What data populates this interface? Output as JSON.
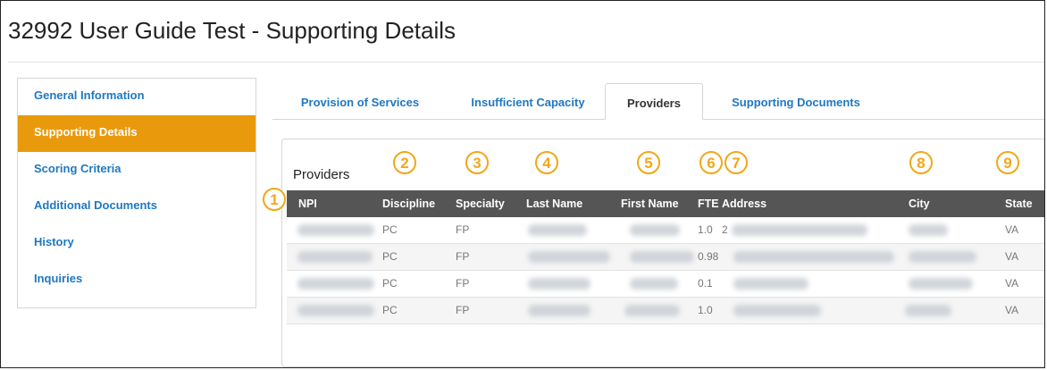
{
  "page": {
    "title": "32992 User Guide Test - Supporting Details"
  },
  "sidebar": {
    "items": [
      {
        "label": "General Information"
      },
      {
        "label": "Supporting Details"
      },
      {
        "label": "Scoring Criteria"
      },
      {
        "label": "Additional Documents"
      },
      {
        "label": "History"
      },
      {
        "label": "Inquiries"
      }
    ],
    "active_item": "Supporting Details",
    "active_color": "#e99a0c"
  },
  "tabs": {
    "items": [
      {
        "label": "Provision of Services"
      },
      {
        "label": "Insufficient Capacity"
      },
      {
        "label": "Providers"
      },
      {
        "label": "Supporting Documents"
      }
    ],
    "active_tab": "Providers"
  },
  "providers": {
    "heading": "Providers",
    "columns": [
      "NPI",
      "Discipline",
      "Specialty",
      "Last Name",
      "First Name",
      "FTE",
      "Address",
      "City",
      "State"
    ],
    "rows": [
      {
        "discipline": "PC",
        "specialty": "FP",
        "fte": "1.0",
        "address_prefix": "2",
        "state": "VA"
      },
      {
        "discipline": "PC",
        "specialty": "FP",
        "fte": "0.98",
        "address_prefix": "",
        "state": "VA"
      },
      {
        "discipline": "PC",
        "specialty": "FP",
        "fte": "0.1",
        "address_prefix": "",
        "state": "VA"
      },
      {
        "discipline": "PC",
        "specialty": "FP",
        "fte": "1.0",
        "address_prefix": "",
        "state": "VA"
      }
    ],
    "redacted_fields": [
      "NPI",
      "Last Name",
      "First Name",
      "Address",
      "City"
    ]
  },
  "callouts": [
    "1",
    "2",
    "3",
    "4",
    "5",
    "6",
    "7",
    "8",
    "9"
  ],
  "colors": {
    "link": "#1f78c1",
    "accent": "#e99a0c",
    "header_bg": "#555555",
    "callout": "#f0a818"
  }
}
